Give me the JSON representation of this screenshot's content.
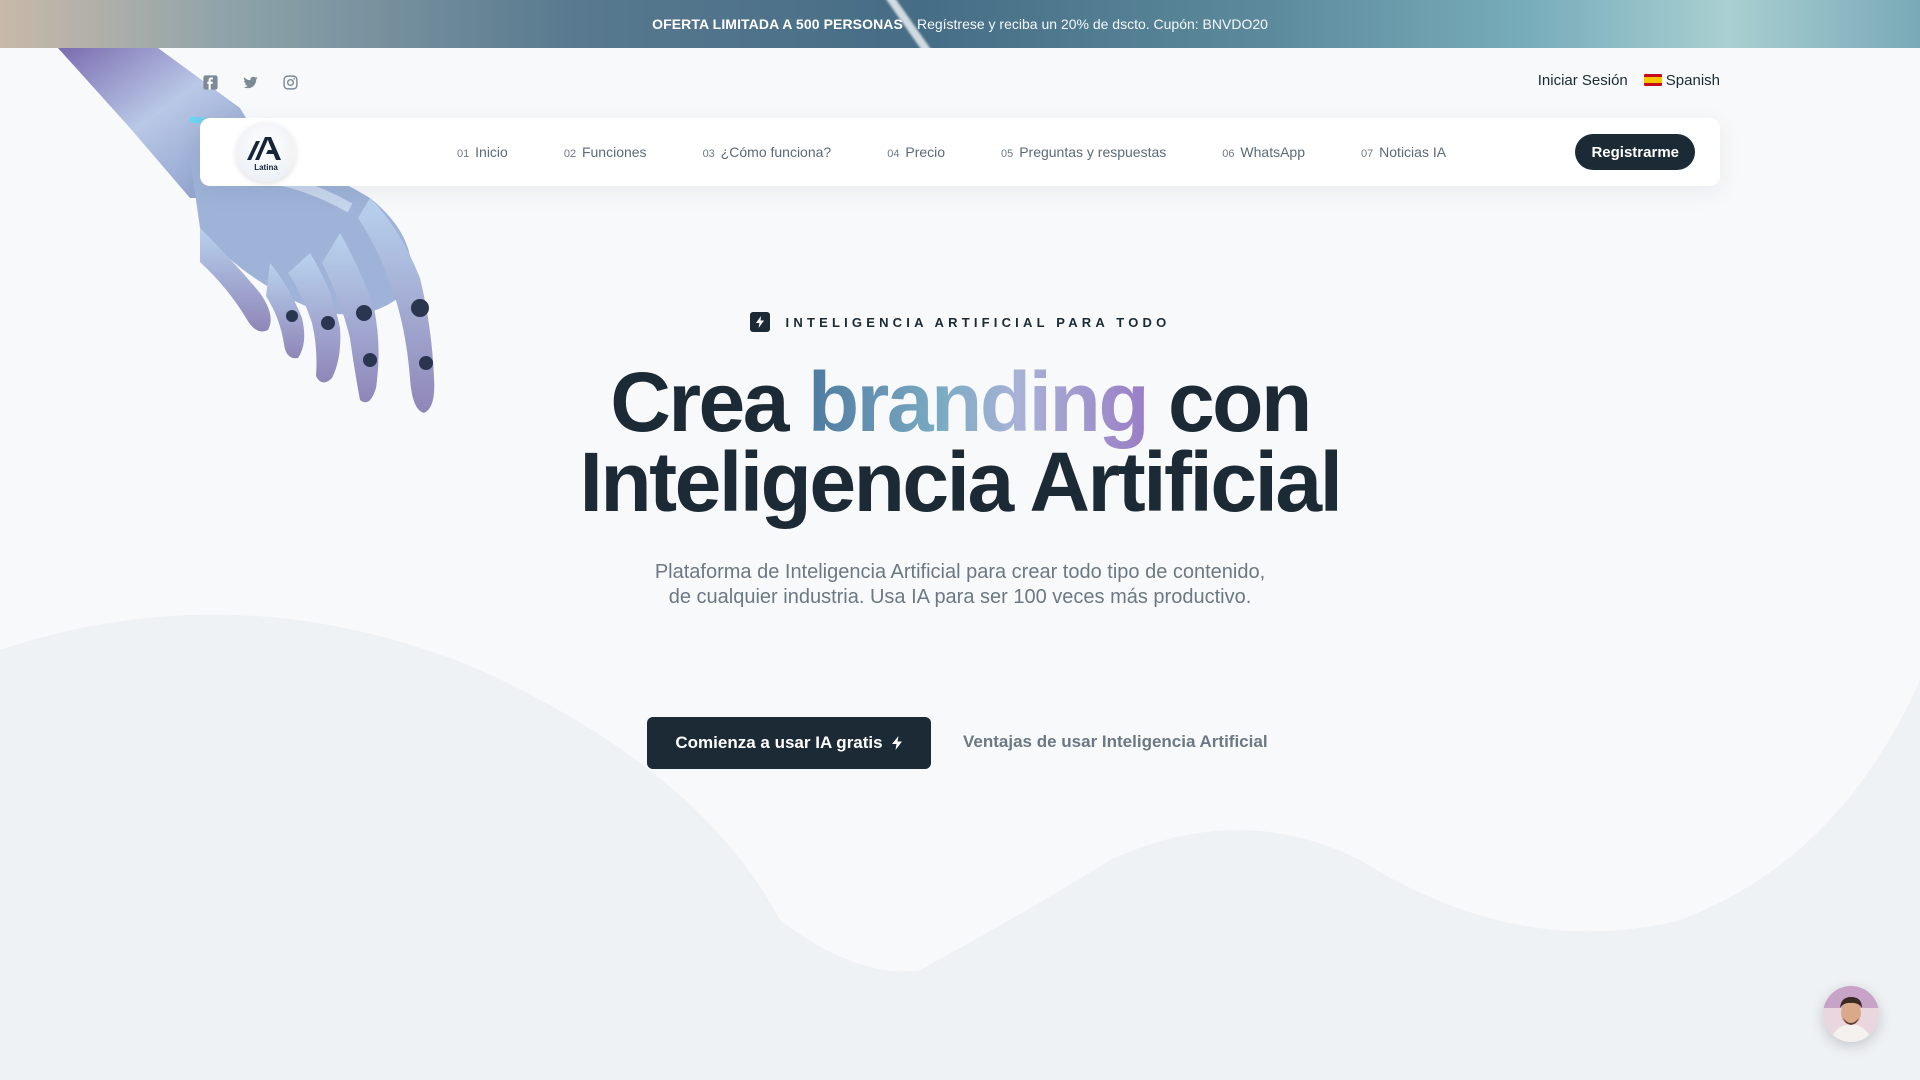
{
  "promo": {
    "highlight": "OFERTA LIMITADA A 500 PERSONAS",
    "text": "Regístrese y reciba un 20% de dscto. Cupón: BNVDO20"
  },
  "socials": [
    {
      "icon": "facebook-icon"
    },
    {
      "icon": "twitter-icon"
    },
    {
      "icon": "instagram-icon"
    }
  ],
  "utility": {
    "login": "Iniciar Sesión",
    "language": "Spanish",
    "language_flag": "spain-flag-icon"
  },
  "logo": {
    "caption": "Latina",
    "mark": "IA"
  },
  "nav": {
    "items": [
      {
        "num": "01",
        "label": "Inicio"
      },
      {
        "num": "02",
        "label": "Funciones"
      },
      {
        "num": "03",
        "label": "¿Cómo funciona?"
      },
      {
        "num": "04",
        "label": "Precio"
      },
      {
        "num": "05",
        "label": "Preguntas y respuestas"
      },
      {
        "num": "06",
        "label": "WhatsApp"
      },
      {
        "num": "07",
        "label": "Noticias IA"
      }
    ],
    "register": "Registrarme"
  },
  "hero": {
    "eyebrow": "INTELIGENCIA ARTIFICIAL PARA TODO",
    "eyebrow_icon": "bolt-icon",
    "title_part1": "Crea",
    "title_highlight": "branding",
    "title_part2": "con",
    "title_line2": "Inteligencia Artificial",
    "subtitle": "Plataforma de Inteligencia Artificial para crear todo tipo de contenido, de cualquier industria. Usa IA para ser 100 veces más productivo.",
    "cta_primary": "Comienza a usar IA gratis",
    "cta_primary_icon": "bolt-icon",
    "cta_secondary": "Ventajas de usar Inteligencia Artificial"
  },
  "colors": {
    "primary": "#1b2a35",
    "muted": "#6c7884",
    "background": "#f8f9fb",
    "accent_gradient_start": "#4f7aa0",
    "accent_gradient_end": "#9a7ec6"
  }
}
